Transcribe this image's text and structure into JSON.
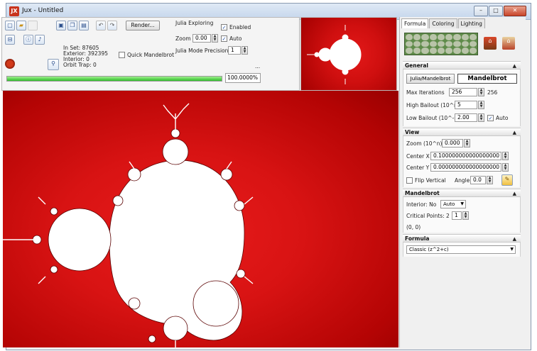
{
  "window": {
    "title": "Jux - Untitled",
    "app_icon_text": "JX"
  },
  "toolbar": {
    "render_label": "Render...",
    "stats": {
      "in_set": "In Set: 87605",
      "exterior": "Exterior: 392395",
      "interior": "Interior: 0",
      "orbit_trap": "Orbit Trap: 0"
    },
    "quick_mandelbrot_label": "Quick Mandelbrot",
    "julia_exploring_label": "Julia Exploring",
    "enabled_label": "Enabled",
    "zoom_label": "Zoom",
    "zoom_value": "0.00",
    "auto_label": "Auto",
    "julia_precision_label": "Julia Mode Precision",
    "julia_precision_value": "1",
    "ellipsis": "...",
    "progress_fraction": 1.0,
    "progress_text": "100.0000%"
  },
  "panel": {
    "tabs": [
      "Formula",
      "Coloring",
      "Lighting"
    ],
    "general": {
      "title": "General",
      "julia_mandelbrot_label": "Julia/Mandelbrot",
      "mandelbrot_label": "Mandelbrot",
      "max_iterations_label": "Max Iterations",
      "max_iterations_value": "256",
      "max_iterations_readout": "256",
      "high_bailout_label": "High Bailout (10^n)",
      "high_bailout_value": "5",
      "low_bailout_label": "Low Bailout (10^-n)",
      "low_bailout_value": "2.00",
      "auto_label": "Auto"
    },
    "view": {
      "title": "View",
      "zoom_label": "Zoom (10^n)",
      "zoom_value": "0.000",
      "center_x_label": "Center X",
      "center_x_value": "0.100000000000000000",
      "center_y_label": "Center Y",
      "center_y_value": "0.000000000000000000",
      "flip_vertical_label": "Flip Vertical",
      "angle_label": "Angle",
      "angle_value": "0.0"
    },
    "mandelbrot": {
      "title": "Mandelbrot",
      "interior_label": "Interior: No",
      "interior_select": "Auto",
      "critical_points_label": "Critical Points: 2",
      "critical_points_value": "1",
      "point_text": "(0, 0)"
    },
    "formula": {
      "title": "Formula",
      "formula_select": "Classic (z^2+c)"
    }
  },
  "colors": {
    "fractal_red": "#d81313",
    "set_white": "#ffffff",
    "progress_green": "#2fbd2a"
  }
}
